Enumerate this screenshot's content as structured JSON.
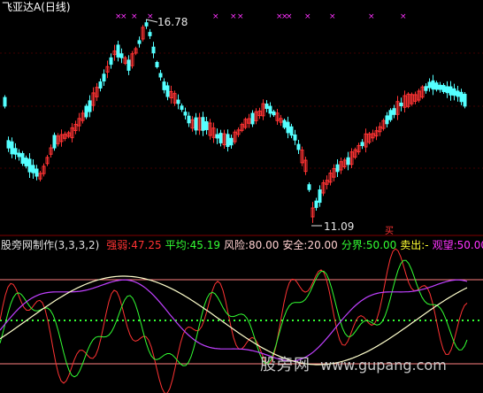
{
  "header": {
    "stock_name": "飞亚达A",
    "period": "(日线)"
  },
  "price_panel": {
    "high_label": "16.78",
    "low_label": "11.09",
    "signal_glyph": "买"
  },
  "indicator_panel": {
    "title": "股旁网制作(3,3,3,2)",
    "fields": [
      {
        "label": "强弱",
        "value": "47.25",
        "color": "#ff3333"
      },
      {
        "label": "平均",
        "value": "45.19",
        "color": "#33ff33"
      },
      {
        "label": "风险",
        "value": "80.00",
        "color": "#ffd0d0"
      },
      {
        "label": "安全",
        "value": "20.00",
        "color": "#ffd0d0"
      },
      {
        "label": "分界",
        "value": "50.00",
        "color": "#33ff33"
      },
      {
        "label": "卖出",
        "value": "-",
        "color": "#ffff33"
      },
      {
        "label": "观望",
        "value": "50.00",
        "color": "#ff33ff"
      }
    ]
  },
  "watermark": {
    "cn": "股旁网",
    "url": "www.gupang.com"
  },
  "colors": {
    "up": "#ff3333",
    "down": "#54ffff",
    "marker": "#ff33ff",
    "strength": "#ff3333",
    "average": "#33ff33",
    "purple": "#c040ff",
    "white_line": "#ffffcc",
    "band": "#ff8080"
  }
}
